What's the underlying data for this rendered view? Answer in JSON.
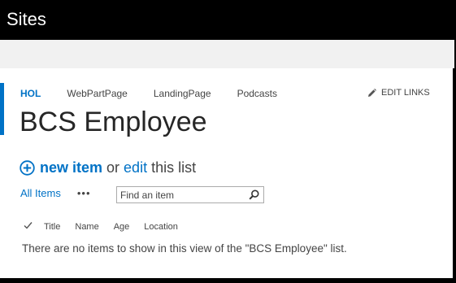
{
  "suite_bar": {
    "title": "Sites"
  },
  "top_nav": {
    "items": [
      {
        "label": "HOL",
        "active": true
      },
      {
        "label": "WebPartPage",
        "active": false
      },
      {
        "label": "LandingPage",
        "active": false
      },
      {
        "label": "Podcasts",
        "active": false
      }
    ],
    "edit_links_label": "EDIT LINKS",
    "edit_icon": "pencil-icon"
  },
  "page": {
    "title": "BCS Employee"
  },
  "actions": {
    "plus_icon": "plus-circle-icon",
    "new_item_label": "new item",
    "or_text": "or",
    "edit_label": "edit",
    "suffix_text": "this list"
  },
  "view_bar": {
    "view_label": "All Items",
    "more_label": "•••",
    "search_placeholder": "Find an item",
    "search_icon": "search-icon"
  },
  "table": {
    "columns": [
      "Title",
      "Name",
      "Age",
      "Location"
    ],
    "empty_message": "There are no items to show in this view of the \"BCS Employee\" list."
  },
  "colors": {
    "accent": "#0072c6",
    "suite_bar": "#000000",
    "ribbon": "#f1f1f1",
    "text": "#444444"
  }
}
